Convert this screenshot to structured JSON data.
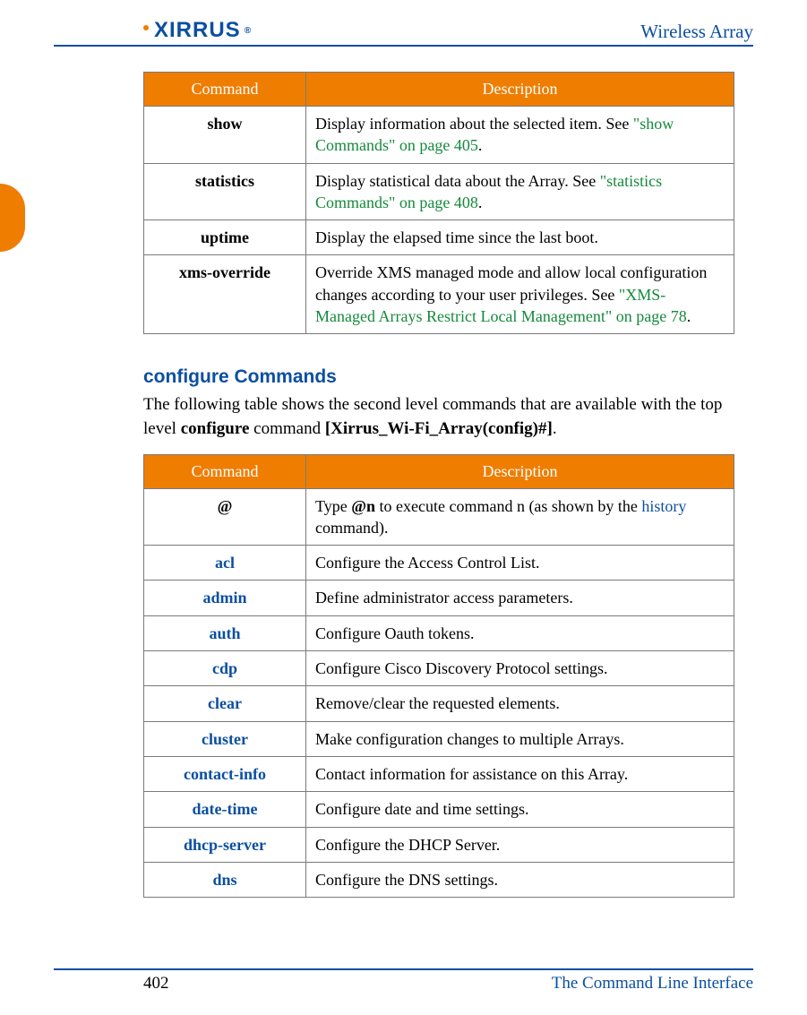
{
  "header": {
    "logo_text": "XIRRUS",
    "right_text": "Wireless Array"
  },
  "table1": {
    "headers": {
      "command": "Command",
      "description": "Description"
    },
    "rows": [
      {
        "cmd": "show",
        "is_link": false,
        "desc_pre": "Display information about the selected item. See ",
        "xref": "\"show Commands\" on page 405",
        "desc_post": "."
      },
      {
        "cmd": "statistics",
        "is_link": false,
        "desc_pre": "Display statistical data about the Array. See ",
        "xref": "\"statistics Commands\" on page 408",
        "desc_post": "."
      },
      {
        "cmd": "uptime",
        "is_link": false,
        "desc_pre": "Display the elapsed time since the last boot.",
        "xref": "",
        "desc_post": ""
      },
      {
        "cmd": "xms-override",
        "is_link": false,
        "desc_pre": "Override XMS managed mode and allow local configuration changes according to your user privileges. See ",
        "xref": "\"XMS-Managed Arrays Restrict Local Management\" on page 78",
        "desc_post": "."
      }
    ]
  },
  "section": {
    "title": "configure Commands",
    "intro_pre": "The following table shows the second level commands that are available with the top level ",
    "intro_bold1": "configure",
    "intro_mid": " command ",
    "intro_bold2": "[Xirrus_Wi-Fi_Array(config)#]",
    "intro_post": "."
  },
  "table2": {
    "headers": {
      "command": "Command",
      "description": "Description"
    },
    "rows": [
      {
        "cmd": "@",
        "is_link": false,
        "desc_pre": "Type ",
        "bold": "@n",
        "desc_mid": " to execute command n (as shown by the ",
        "link": "history",
        "desc_post": " command)."
      },
      {
        "cmd": "acl",
        "is_link": true,
        "desc": "Configure the Access Control List."
      },
      {
        "cmd": "admin",
        "is_link": true,
        "desc": "Define administrator access parameters."
      },
      {
        "cmd": "auth",
        "is_link": true,
        "desc": " Configure Oauth tokens."
      },
      {
        "cmd": "cdp",
        "is_link": true,
        "desc": " Configure Cisco Discovery Protocol settings."
      },
      {
        "cmd": "clear",
        "is_link": true,
        "desc": "Remove/clear the requested elements."
      },
      {
        "cmd": "cluster",
        "is_link": true,
        "desc": "Make configuration changes to multiple Arrays."
      },
      {
        "cmd": "contact-info",
        "is_link": true,
        "desc": "Contact information for assistance on this Array."
      },
      {
        "cmd": "date-time",
        "is_link": true,
        "desc": "Configure date and time settings."
      },
      {
        "cmd": "dhcp-server",
        "is_link": true,
        "desc": "Configure the DHCP Server."
      },
      {
        "cmd": "dns",
        "is_link": true,
        "desc": "Configure the DNS settings."
      }
    ]
  },
  "footer": {
    "page_number": "402",
    "chapter": "The Command Line Interface"
  }
}
